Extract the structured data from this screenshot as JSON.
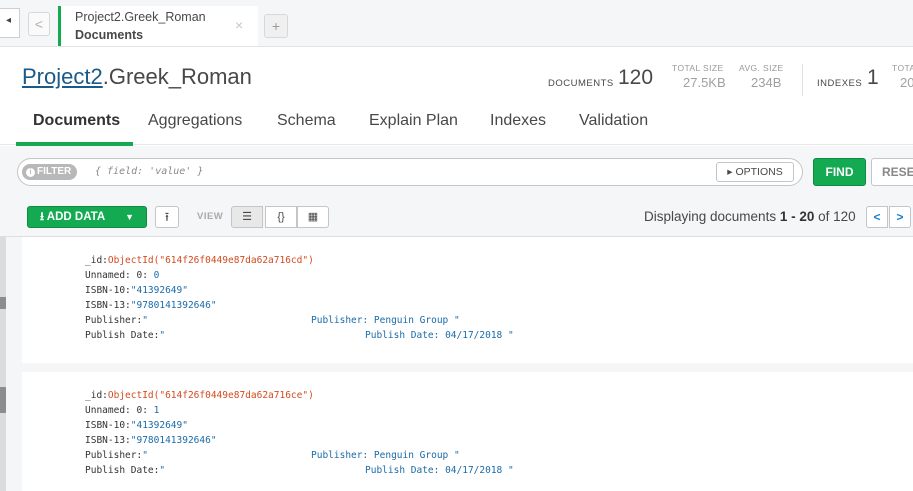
{
  "tab": {
    "title_line1": "Project2.Greek_Roman",
    "title_line2": "Documents",
    "close_glyph": "×",
    "new_tab_glyph": "+",
    "left_glyph": "◂",
    "back_glyph": "<"
  },
  "collection": {
    "database": "Project2",
    "name": ".Greek_Roman"
  },
  "stats": {
    "documents_label": "DOCUMENTS",
    "documents_value": "120",
    "total_size_label": "TOTAL SIZE",
    "total_size_value": "27.5KB",
    "avg_size_label": "AVG. SIZE",
    "avg_size_value": "234B",
    "indexes_label": "INDEXES",
    "indexes_value": "1",
    "total_label_cut": "TOTA",
    "total_value_cut": "20"
  },
  "subtabs": [
    "Documents",
    "Aggregations",
    "Schema",
    "Explain Plan",
    "Indexes",
    "Validation"
  ],
  "filter": {
    "pill_label": "FILTER",
    "placeholder": "{ field: 'value' }",
    "options_label": "▸ OPTIONS",
    "find_label": "FIND",
    "reset_label": "RESE"
  },
  "controls": {
    "add_data_label": "ADD DATA",
    "add_data_caret": "▼",
    "export_glyph": "⭱",
    "view_label": "VIEW",
    "view_list_glyph": "☰",
    "view_json_glyph": "{}",
    "view_table_glyph": "▦",
    "displaying_prefix": "Displaying documents ",
    "range": "1 - 20",
    "of_text": " of 120",
    "prev_glyph": "<",
    "next_glyph": ">"
  },
  "documents": [
    {
      "id_key": "_id:",
      "id_value": "ObjectId(\"614f26f0449e87da62a716cd\")",
      "unnamed_key": "Unnamed: 0:",
      "unnamed_value": "0",
      "isbn10_key": "ISBN-10:",
      "isbn10_value": "\"41392649\"",
      "isbn13_key": "ISBN-13:",
      "isbn13_value": "\"9780141392646\"",
      "publisher_key": "Publisher:",
      "publisher_value": "\"",
      "publisher_extra": "Publisher: Penguin Group \"",
      "pubdate_key": "Publish Date:",
      "pubdate_value": "\"",
      "pubdate_extra": "Publish Date: 04/17/2018 \""
    },
    {
      "id_key": "_id:",
      "id_value": "ObjectId(\"614f26f0449e87da62a716ce\")",
      "unnamed_key": "Unnamed: 0:",
      "unnamed_value": "1",
      "isbn10_key": "ISBN-10:",
      "isbn10_value": "\"41392649\"",
      "isbn13_key": "ISBN-13:",
      "isbn13_value": "\"9780141392646\"",
      "publisher_key": "Publisher:",
      "publisher_value": "\"",
      "publisher_extra": "Publisher: Penguin Group \"",
      "pubdate_key": "Publish Date:",
      "pubdate_value": "\"",
      "pubdate_extra": "Publish Date: 04/17/2018 \""
    }
  ],
  "colors": {
    "accent_green": "#13aa52",
    "link_blue": "#1a5a87",
    "string_blue": "#1a6ba8",
    "objectid_orange": "#d34a1e"
  }
}
